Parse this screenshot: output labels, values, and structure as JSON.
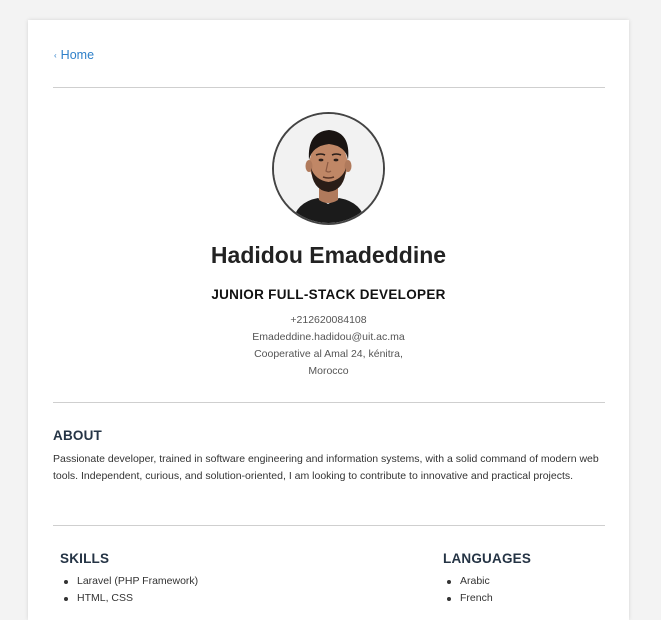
{
  "nav": {
    "back_label": "Home",
    "back_icon": "arrow-left-icon"
  },
  "profile": {
    "name": "Hadidou Emadeddine",
    "role": "JUNIOR FULL-STACK DEVELOPER",
    "phone": "+212620084108",
    "email": "Emadeddine.hadidou@uit.ac.ma",
    "address_line1": "Cooperative al Amal 24, kénitra,",
    "address_line2": "Morocco"
  },
  "about": {
    "title": "ABOUT",
    "text": "Passionate developer, trained in software engineering and information systems, with a solid command of modern web tools. Independent, curious, and solution-oriented, I am looking to contribute to innovative and practical projects."
  },
  "skills": {
    "title": "SKILLS",
    "items": [
      "Laravel (PHP Framework)",
      "HTML, CSS"
    ]
  },
  "languages": {
    "title": "LANGUAGES",
    "items": [
      "Arabic",
      "French"
    ]
  }
}
